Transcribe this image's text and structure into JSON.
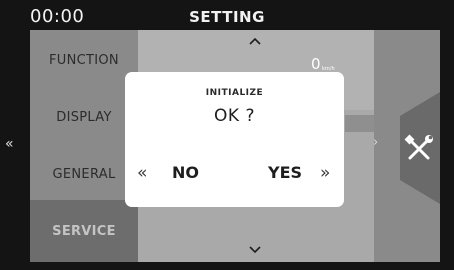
{
  "status_bar": {
    "time": "00:00",
    "title": "SETTING"
  },
  "menu": {
    "items": [
      {
        "label": "FUNCTION"
      },
      {
        "label": "DISPLAY"
      },
      {
        "label": "GENERAL"
      },
      {
        "label": "SERVICE",
        "selected": true
      }
    ]
  },
  "speed": {
    "value": "0",
    "unit": "km/h"
  },
  "dialog": {
    "title": "INITIALIZE",
    "question": "OK ?",
    "no_label": "NO",
    "yes_label": "YES",
    "no_arrow": "«",
    "yes_arrow": "»"
  },
  "nav": {
    "back_arrow": "«",
    "up": "^",
    "down": "⌄",
    "right": "›"
  },
  "icons": {
    "tools": "wrench-screwdriver-icon"
  },
  "colors": {
    "background": "#141414",
    "menu_panel": "#8a8a8a",
    "content_panel": "#a9a9a9",
    "dialog": "#ffffff",
    "selected_item": "#6d6d6d"
  }
}
